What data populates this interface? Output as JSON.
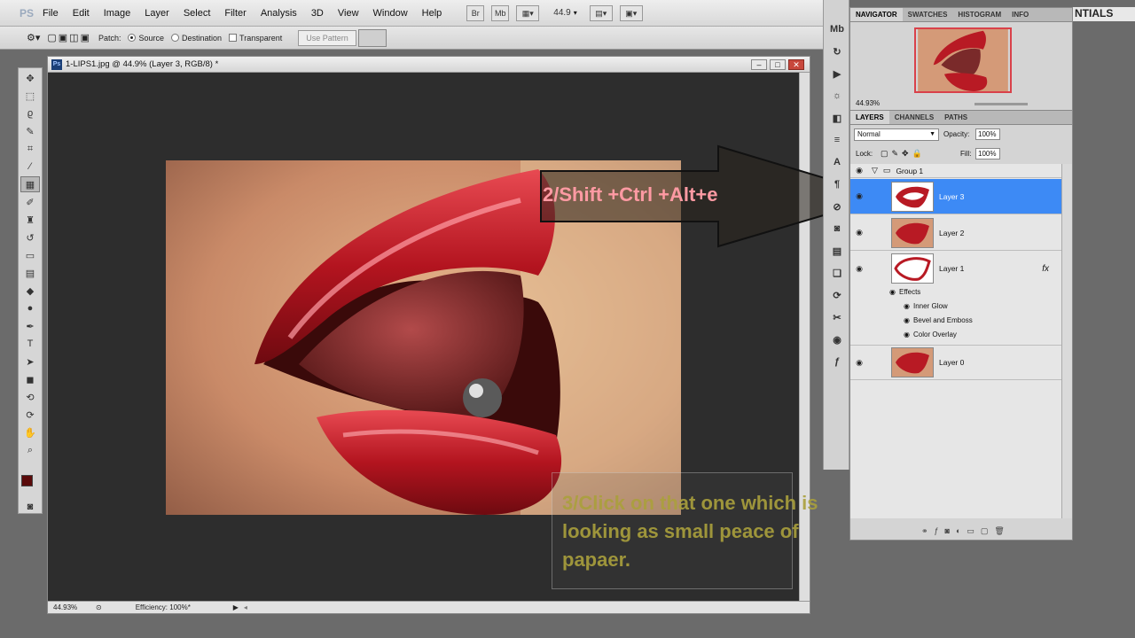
{
  "menubar": {
    "logo": "PS",
    "items": [
      "File",
      "Edit",
      "Image",
      "Layer",
      "Select",
      "Filter",
      "Analysis",
      "3D",
      "View",
      "Window",
      "Help"
    ],
    "bridge_label": "Br",
    "minibridge_label": "Mb",
    "zoom": "44.9",
    "workspace": "NTIALS"
  },
  "options": {
    "patch_label": "Patch:",
    "source_label": "Source",
    "destination_label": "Destination",
    "transparent_label": "Transparent",
    "use_pattern_label": "Use Pattern"
  },
  "document": {
    "title": "1-LIPS1.jpg @ 44.9% (Layer 3, RGB/8) *",
    "zoom_status": "44.93%",
    "efficiency": "Efficiency: 100%*"
  },
  "annotations": {
    "callout": "2/Shift +Ctrl +Alt+e",
    "instruction": "3/Click on that one which is\nlooking as small peace of\npapaer."
  },
  "navigator": {
    "tabs": [
      "NAVIGATOR",
      "SWATCHES",
      "HISTOGRAM",
      "INFO"
    ],
    "zoom": "44.93%"
  },
  "layers": {
    "tabs": [
      "LAYERS",
      "CHANNELS",
      "PATHS"
    ],
    "blend_mode": "Normal",
    "opacity_label": "Opacity:",
    "opacity": "100%",
    "lock_label": "Lock:",
    "fill_label": "Fill:",
    "fill": "100%",
    "group_name": "Group 1",
    "items": [
      {
        "name": "Layer 3",
        "selected": true
      },
      {
        "name": "Layer 2"
      },
      {
        "name": "Layer 1",
        "has_fx": true
      },
      {
        "name": "Layer 0"
      }
    ],
    "effects_label": "Effects",
    "effects": [
      "Inner Glow",
      "Bevel and Emboss",
      "Color Overlay"
    ],
    "fx_label": "fx"
  },
  "colors": {
    "selection": "#3d8af5",
    "foreground": "#5a0a0a",
    "callout_text": "#ff9aa3",
    "instruction_text": "#aaa03c"
  }
}
